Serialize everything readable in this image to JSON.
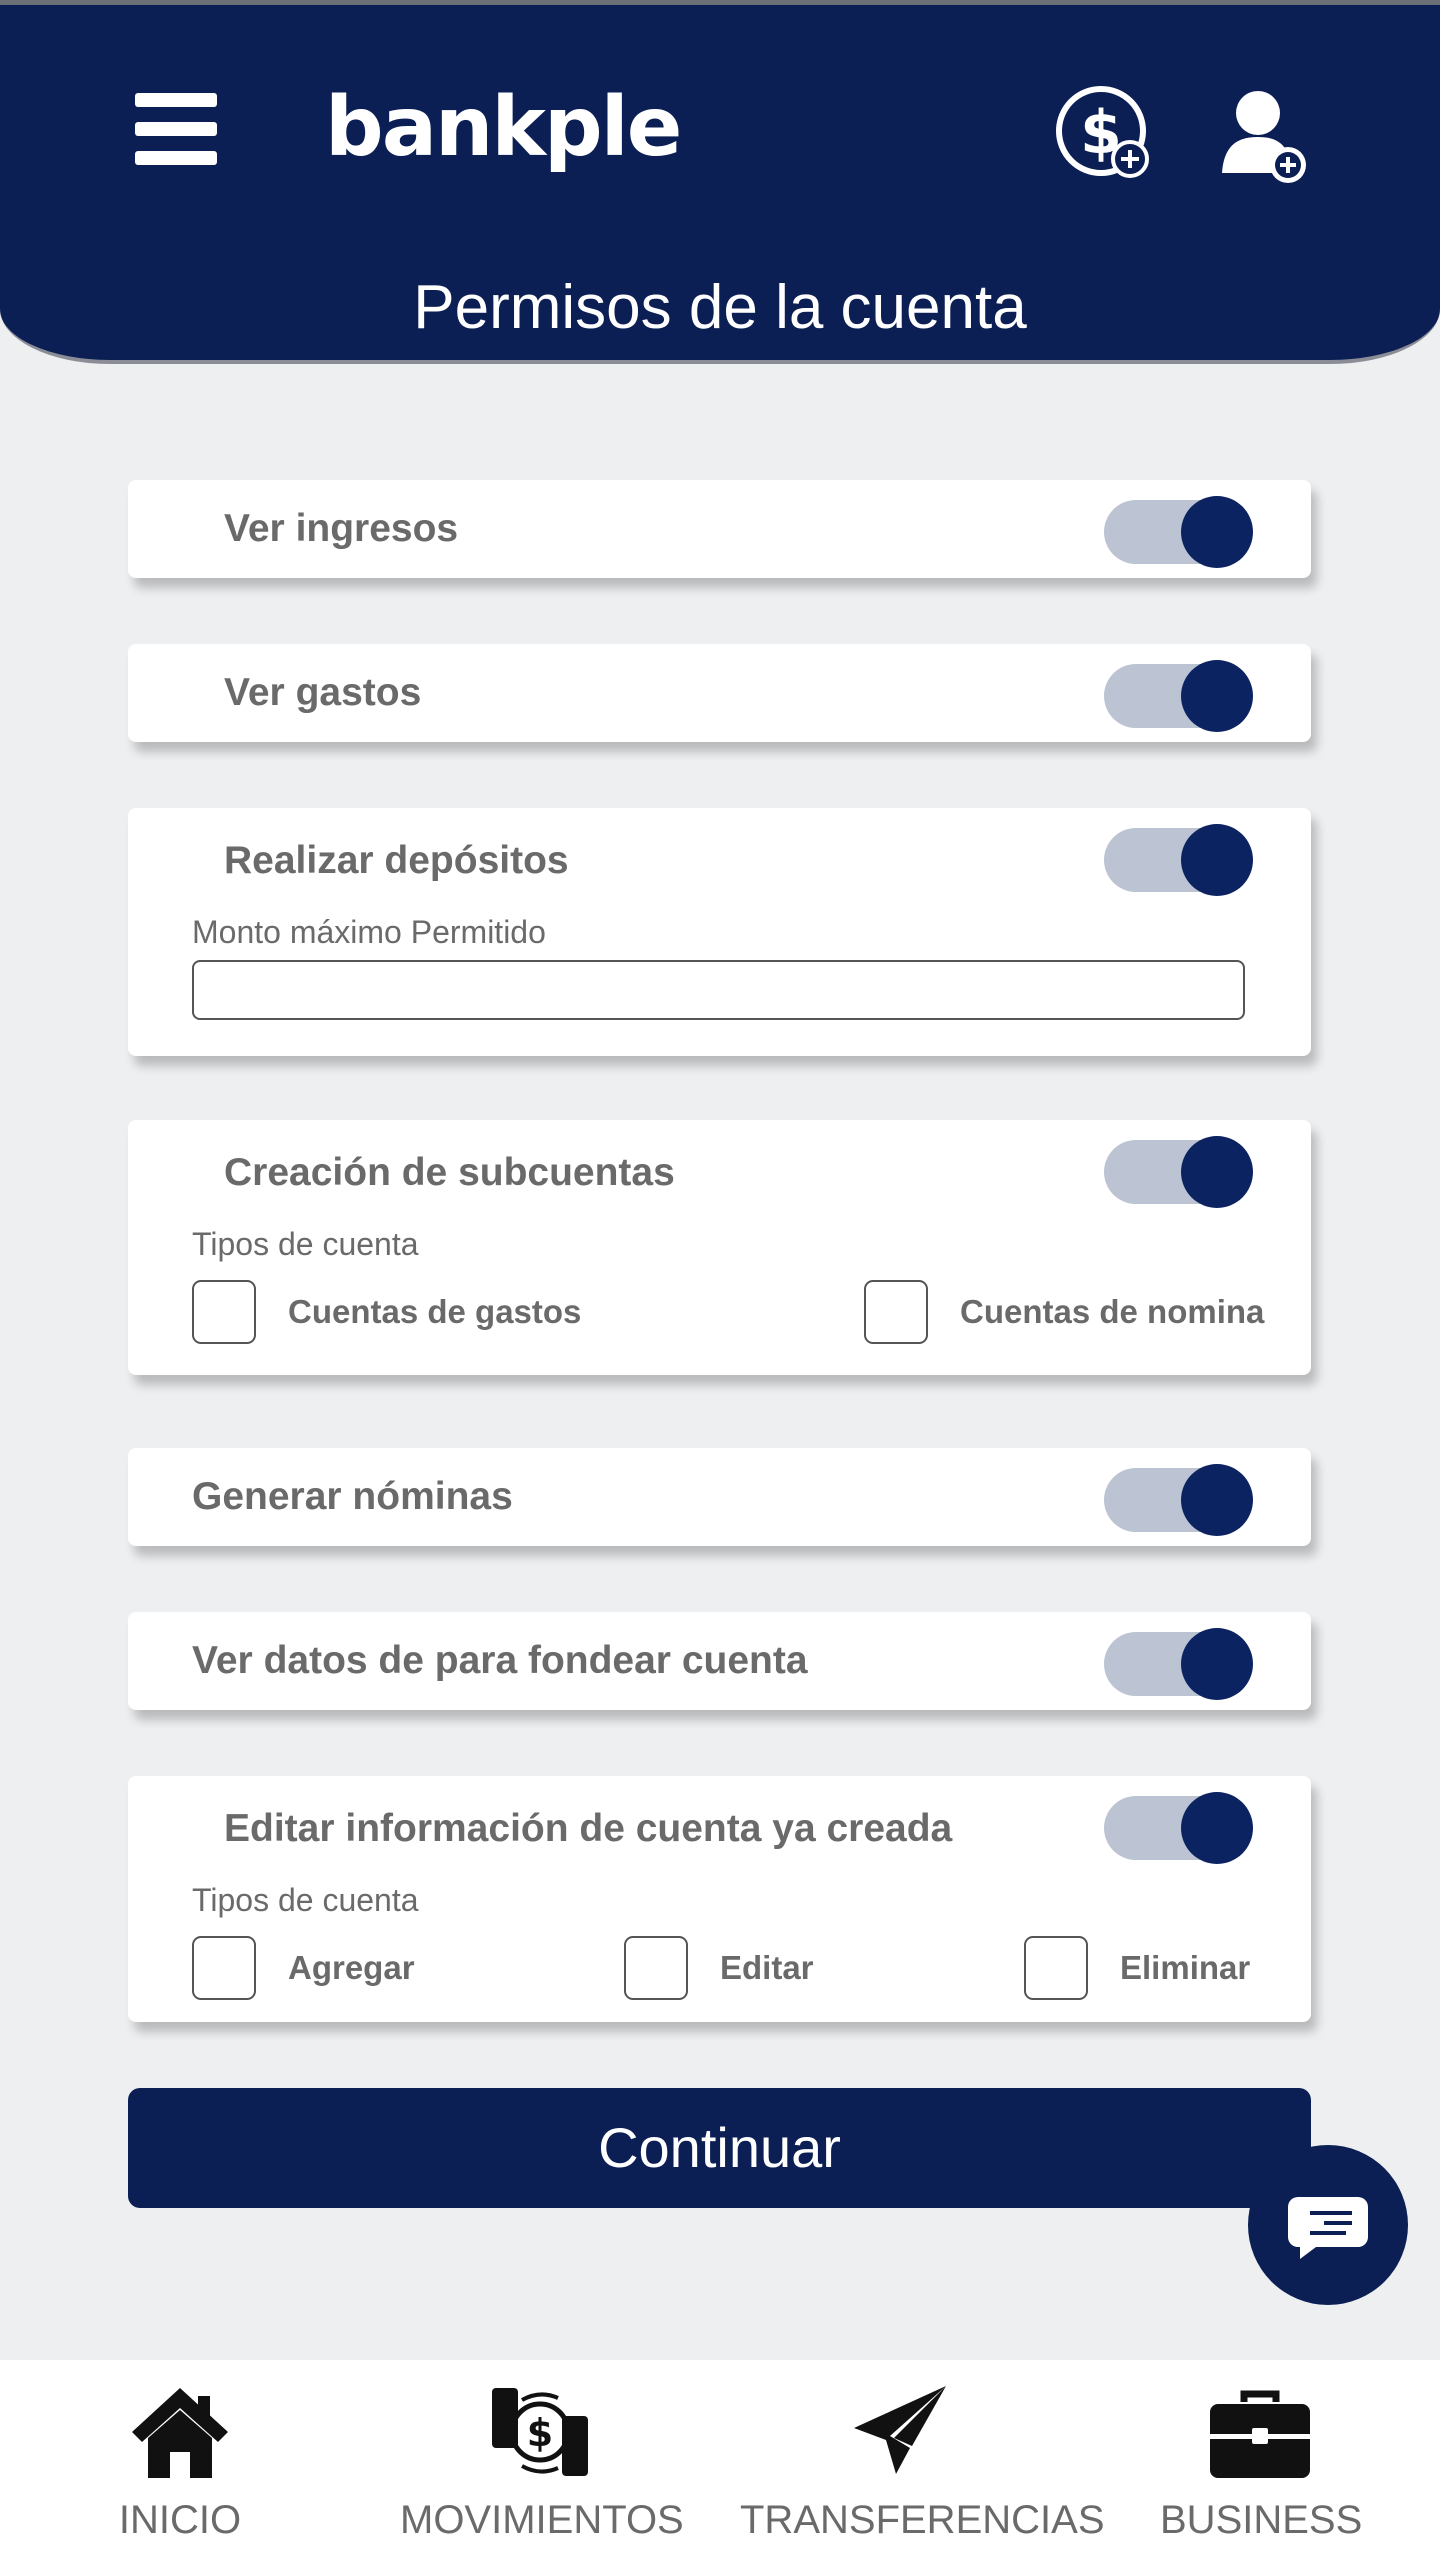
{
  "header": {
    "logo_text": "bankple",
    "title": "Permisos de la cuenta",
    "icons": [
      "menu-icon",
      "dollar-plus-icon",
      "user-plus-icon"
    ]
  },
  "permissions": [
    {
      "label": "Ver ingresos",
      "enabled": true
    },
    {
      "label": "Ver gastos",
      "enabled": true
    },
    {
      "label": "Realizar depósitos",
      "enabled": true,
      "field_label": "Monto máximo Permitido",
      "field_value": ""
    },
    {
      "label": "Creación de subcuentas",
      "enabled": true,
      "sublabel": "Tipos de cuenta",
      "options": [
        "Cuentas de gastos",
        "Cuentas de nomina"
      ]
    },
    {
      "label": "Generar nóminas",
      "enabled": true
    },
    {
      "label": "Ver datos de para fondear cuenta",
      "enabled": true
    },
    {
      "label": "Editar información de cuenta ya creada",
      "enabled": true,
      "sublabel": "Tipos de cuenta",
      "options": [
        "Agregar",
        "Editar",
        "Eliminar"
      ]
    }
  ],
  "continue_label": "Continuar",
  "nav": [
    {
      "label": "INICIO",
      "icon": "home-icon"
    },
    {
      "label": "MOVIMIENTOS",
      "icon": "money-exchange-icon"
    },
    {
      "label": "TRANSFERENCIAS",
      "icon": "paper-plane-icon"
    },
    {
      "label": "BUSINESS",
      "icon": "briefcase-icon"
    }
  ],
  "colors": {
    "primary": "#0c1f54",
    "toggle_track": "#bcc3d2",
    "background": "#eeeff1"
  }
}
